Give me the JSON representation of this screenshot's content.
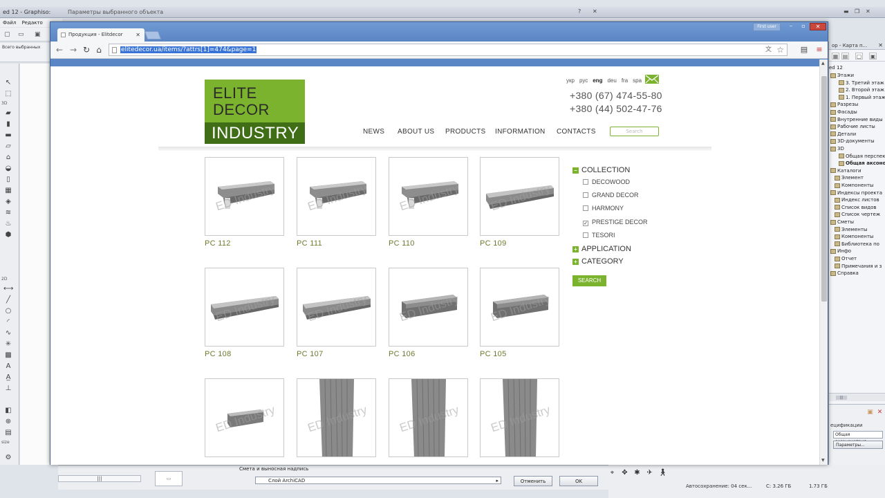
{
  "archicad": {
    "title": "ed 12 - Graphiso:",
    "dialog_title": "Параметры выбранного объекта",
    "menu": [
      "Файл",
      "Редакто"
    ],
    "info_text": "Всего выбранных",
    "toolbox_groups": [
      "3D",
      "2D"
    ],
    "toolbox_size_label": "size",
    "navigator": {
      "title": "ор - Карта п...",
      "root": "ed 12",
      "items": [
        {
          "label": "Этажи",
          "indent": 0
        },
        {
          "label": "3. Третий этаж",
          "indent": 2
        },
        {
          "label": "2. Второй этаж",
          "indent": 2
        },
        {
          "label": "1. Первый этаж",
          "indent": 2
        },
        {
          "label": "Разрезы",
          "indent": 0
        },
        {
          "label": "Фасады",
          "indent": 0
        },
        {
          "label": "Внутренние виды",
          "indent": 0
        },
        {
          "label": "Рабочие листы",
          "indent": 0
        },
        {
          "label": "Детали",
          "indent": 0
        },
        {
          "label": "3D-документы",
          "indent": 0
        },
        {
          "label": "3D",
          "indent": 0
        },
        {
          "label": "Общая перспек",
          "indent": 2
        },
        {
          "label": "Общая аксоно",
          "indent": 2
        },
        {
          "label": "Каталоги",
          "indent": 0
        },
        {
          "label": "Элемент",
          "indent": 1
        },
        {
          "label": "Компоненты",
          "indent": 1
        },
        {
          "label": "Индексы проекта",
          "indent": 0
        },
        {
          "label": "Индекс листов",
          "indent": 1
        },
        {
          "label": "Список видов",
          "indent": 1
        },
        {
          "label": "Список чертеж",
          "indent": 1
        },
        {
          "label": "Сметы",
          "indent": 0
        },
        {
          "label": "Элементы",
          "indent": 1
        },
        {
          "label": "Компоненты",
          "indent": 1
        },
        {
          "label": "Библиотека по",
          "indent": 1
        },
        {
          "label": "Инфо",
          "indent": 0
        },
        {
          "label": "Отчет",
          "indent": 1
        },
        {
          "label": "Примечания и з",
          "indent": 1
        },
        {
          "label": "Справка",
          "indent": 0
        }
      ],
      "selected_index": 12,
      "bottom_label": "ецификации",
      "view_field": "Общая аксонометрия",
      "params_button": "Параметры..."
    },
    "bottom": {
      "layer_header": "Смета и выносная надпись",
      "layer_value": "Слой ArchiCAD",
      "cancel": "Отменить",
      "ok": "OK"
    },
    "status": {
      "autosave": "Автосохранение: 04 сек...",
      "disk": "С: 3.26 ГБ",
      "memory": "1.73 ГБ"
    }
  },
  "browser": {
    "tab_title": "Продукция - Elitdecor",
    "user_button": "First user",
    "url": "elitedecor.ua/items/?attrs[1]=474&page=1"
  },
  "site": {
    "logo": {
      "line1": "ELITE",
      "line2": "DECOR",
      "line3": "INDUSTRY"
    },
    "languages": [
      {
        "code": "укр",
        "active": false
      },
      {
        "code": "рус",
        "active": false
      },
      {
        "code": "eng",
        "active": true
      },
      {
        "code": "deu",
        "active": false
      },
      {
        "code": "fra",
        "active": false
      },
      {
        "code": "spa",
        "active": false
      }
    ],
    "phones": [
      "+380 (67) 474-55-80",
      "+380 (44) 502-47-76"
    ],
    "menu": [
      "NEWS",
      "ABOUT US",
      "PRODUCTS",
      "INFORMATION",
      "CONTACTS"
    ],
    "search_placeholder": "Search",
    "watermark": "ED Industry",
    "products": [
      {
        "name": "PC 112",
        "shape": "cornice-wide"
      },
      {
        "name": "PC 111",
        "shape": "cornice-wide"
      },
      {
        "name": "PC 110",
        "shape": "cornice-wide"
      },
      {
        "name": "PC 109",
        "shape": "cornice-long"
      },
      {
        "name": "PC 108",
        "shape": "cornice-long"
      },
      {
        "name": "PC 107",
        "shape": "cornice-long"
      },
      {
        "name": "PC 106",
        "shape": "block"
      },
      {
        "name": "PC 105",
        "shape": "block"
      },
      {
        "name": "",
        "shape": "small-block"
      },
      {
        "name": "",
        "shape": "panel"
      },
      {
        "name": "",
        "shape": "panel"
      },
      {
        "name": "",
        "shape": "panel"
      }
    ],
    "filters": {
      "collection_label": "COLLECTION",
      "options": [
        {
          "label": "DECOWOOD",
          "checked": false
        },
        {
          "label": "GRAND DECOR",
          "checked": false
        },
        {
          "label": "HARMONY",
          "checked": false
        },
        {
          "label": "PRESTIGE DECOR",
          "checked": true
        },
        {
          "label": "TESORI",
          "checked": false
        }
      ],
      "application_label": "APPLICATION",
      "category_label": "CATEGORY",
      "search_button": "SEARCH"
    },
    "colors": {
      "brand_green": "#7bb32e",
      "brand_dark_green": "#3f6e17",
      "product_name": "#6c7a2c"
    }
  }
}
